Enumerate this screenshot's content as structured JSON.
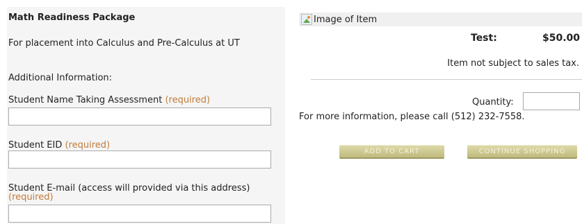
{
  "product": {
    "title": "Math Readiness Package",
    "description": "For placement into Calculus and Pre-Calculus at UT",
    "additional_info": "Additional Information:"
  },
  "form": {
    "required_text": "(required)",
    "fields": [
      {
        "label": "Student Name Taking Assessment",
        "value": ""
      },
      {
        "label": "Student EID",
        "value": ""
      },
      {
        "label": "Student E-mail (access will provided via this address)",
        "value": ""
      }
    ]
  },
  "item": {
    "image_alt": "Image of Item",
    "price_label": "Test:",
    "price_value": "$50.00",
    "tax_note": "Item not subject to sales tax.",
    "quantity_label": "Quantity:",
    "quantity_value": "",
    "info": "For more information, please call (512) 232-7558."
  },
  "buttons": {
    "add_to_cart": "ADD TO CART",
    "continue_shopping": "CONTINUE SHOPPING"
  },
  "colors": {
    "required": "#c27b3a",
    "button": "#cfcb91"
  }
}
